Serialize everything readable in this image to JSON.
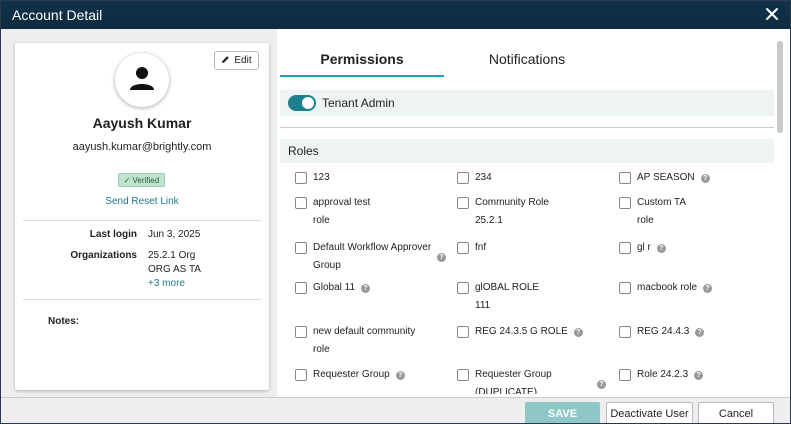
{
  "window": {
    "title": "Account Detail"
  },
  "profile": {
    "edit_label": "Edit",
    "name": "Aayush Kumar",
    "email": "aayush.kumar@brightly.com",
    "verified_label": "Verified",
    "reset_link": "Send Reset Link",
    "last_login_label": "Last login",
    "last_login_value": "Jun 3, 2025",
    "organizations_label": "Organizations",
    "organizations": [
      "25.2.1 Org",
      "ORG AS TA"
    ],
    "more_link": "+3 more",
    "notes_label": "Notes:"
  },
  "tabs": [
    {
      "label": "Permissions",
      "active": true
    },
    {
      "label": "Notifications",
      "active": false
    }
  ],
  "tenant_admin": {
    "label": "Tenant Admin",
    "on": true
  },
  "roles_header": "Roles",
  "roles": [
    {
      "line1": "123",
      "line2": "",
      "help": false,
      "checked": false
    },
    {
      "line1": "234",
      "line2": "",
      "help": false,
      "checked": false
    },
    {
      "line1": "AP SEASON",
      "line2": "",
      "help": true,
      "checked": false
    },
    {
      "line1": "approval test",
      "line2": "role",
      "help": false,
      "checked": false
    },
    {
      "line1": "Community Role",
      "line2": "25.2.1",
      "help": false,
      "checked": false
    },
    {
      "line1": "Custom TA",
      "line2": "role",
      "help": false,
      "checked": false
    },
    {
      "line1": "Default Workflow Approver",
      "line2": "Group",
      "help": true,
      "checked": false
    },
    {
      "line1": "fnf",
      "line2": "",
      "help": false,
      "checked": false
    },
    {
      "line1": "gl r",
      "line2": "",
      "help": true,
      "checked": false
    },
    {
      "line1": "Global 11",
      "line2": "",
      "help": true,
      "checked": false
    },
    {
      "line1": "glOBAL ROLE",
      "line2": "111",
      "help": false,
      "checked": false
    },
    {
      "line1": "macbook role",
      "line2": "",
      "help": true,
      "checked": false
    },
    {
      "line1": "new default community",
      "line2": "role",
      "help": false,
      "checked": false
    },
    {
      "line1": "REG 24.3.5 G ROLE",
      "line2": "",
      "help": true,
      "checked": false
    },
    {
      "line1": "REG 24.4.3",
      "line2": "",
      "help": true,
      "checked": false
    },
    {
      "line1": "Requester Group",
      "line2": "",
      "help": true,
      "checked": false
    },
    {
      "line1": "Requester Group",
      "line2": "(DUPLICATE)",
      "help": true,
      "checked": false
    },
    {
      "line1": "Role 24.2.3",
      "line2": "",
      "help": true,
      "checked": false
    }
  ],
  "footer": {
    "save_label": "SAVE",
    "deactivate_label": "Deactivate User",
    "cancel_label": "Cancel"
  },
  "colors": {
    "titlebar": "#0d2b40",
    "accent": "#1fa4b8",
    "link": "#1f7a8c",
    "toggle_on": "#1f7f8f",
    "save_disabled": "#8fc7c7"
  }
}
